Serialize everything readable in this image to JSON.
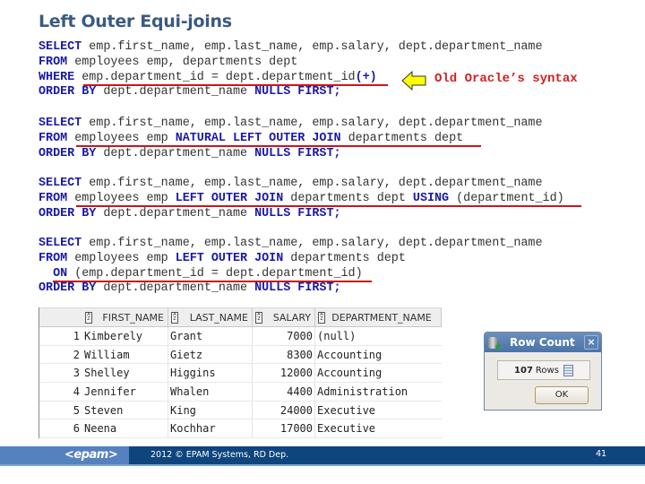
{
  "slide": {
    "title": "Left Outer Equi-joins",
    "note": "Old Oracle’s syntax",
    "arrow_color": "#ffff00",
    "underline_color": "#c8161d"
  },
  "queries": [
    {
      "lines": [
        [
          {
            "k": "SELECT"
          },
          {
            "t": " emp.first_name, emp.last_name, emp.salary, dept.department_name"
          }
        ],
        [
          {
            "k": "FROM"
          },
          {
            "t": " employees emp, departments dept"
          }
        ],
        [
          {
            "k": "WHERE"
          },
          {
            "t": " emp.department_id = dept.department_id"
          },
          {
            "k": "(+)"
          }
        ],
        [
          {
            "k": "ORDER BY"
          },
          {
            "t": " dept.department_name "
          },
          {
            "k": "NULLS FIRST;"
          }
        ]
      ]
    },
    {
      "lines": [
        [
          {
            "k": "SELECT"
          },
          {
            "t": " emp.first_name, emp.last_name, emp.salary, dept.department_name"
          }
        ],
        [
          {
            "k": "FROM"
          },
          {
            "t": " employees emp "
          },
          {
            "k": "NATURAL LEFT OUTER JOIN"
          },
          {
            "t": " departments dept"
          }
        ],
        [
          {
            "k": "ORDER BY"
          },
          {
            "t": " dept.department_name "
          },
          {
            "k": "NULLS FIRST;"
          }
        ]
      ]
    },
    {
      "lines": [
        [
          {
            "k": "SELECT"
          },
          {
            "t": " emp.first_name, emp.last_name, emp.salary, dept.department_name"
          }
        ],
        [
          {
            "k": "FROM"
          },
          {
            "t": " employees emp "
          },
          {
            "k": "LEFT OUTER JOIN"
          },
          {
            "t": " departments dept "
          },
          {
            "k": "USING"
          },
          {
            "t": " (department_id)"
          }
        ],
        [
          {
            "k": "ORDER BY"
          },
          {
            "t": " dept.department_name "
          },
          {
            "k": "NULLS FIRST;"
          }
        ]
      ]
    },
    {
      "lines": [
        [
          {
            "k": "SELECT"
          },
          {
            "t": " emp.first_name, emp.last_name, emp.salary, dept.department_name"
          }
        ],
        [
          {
            "k": "FROM"
          },
          {
            "t": " employees emp "
          },
          {
            "k": "LEFT OUTER JOIN"
          },
          {
            "t": " departments dept"
          }
        ],
        [
          {
            "t": "  "
          },
          {
            "k": "ON"
          },
          {
            "t": " (emp.department_id = dept.department_id)"
          }
        ],
        [
          {
            "k": "ORDER BY"
          },
          {
            "t": " dept.department_name "
          },
          {
            "k": "NULLS FIRST;"
          }
        ]
      ]
    }
  ],
  "results_grid": {
    "columns": [
      "FIRST_NAME",
      "LAST_NAME",
      "SALARY",
      "DEPARTMENT_NAME"
    ],
    "rows": [
      {
        "n": "1",
        "first_name": "Kimberely",
        "last_name": "Grant",
        "salary": "7000",
        "department_name": "(null)"
      },
      {
        "n": "2",
        "first_name": "William",
        "last_name": "Gietz",
        "salary": "8300",
        "department_name": "Accounting"
      },
      {
        "n": "3",
        "first_name": "Shelley",
        "last_name": "Higgins",
        "salary": "12000",
        "department_name": "Accounting"
      },
      {
        "n": "4",
        "first_name": "Jennifer",
        "last_name": "Whalen",
        "salary": "4400",
        "department_name": "Administration"
      },
      {
        "n": "5",
        "first_name": "Steven",
        "last_name": "King",
        "salary": "24000",
        "department_name": "Executive"
      },
      {
        "n": "6",
        "first_name": "Neena",
        "last_name": "Kochhar",
        "salary": "17000",
        "department_name": "Executive"
      }
    ]
  },
  "row_count_dialog": {
    "title": "Row Count",
    "close_label": "×",
    "count": "107",
    "count_suffix": "Rows",
    "ok_label": "OK"
  },
  "footer": {
    "logo": "<epam>",
    "copyright": "2012 © EPAM Systems, RD Dep.",
    "page_number": "41"
  }
}
